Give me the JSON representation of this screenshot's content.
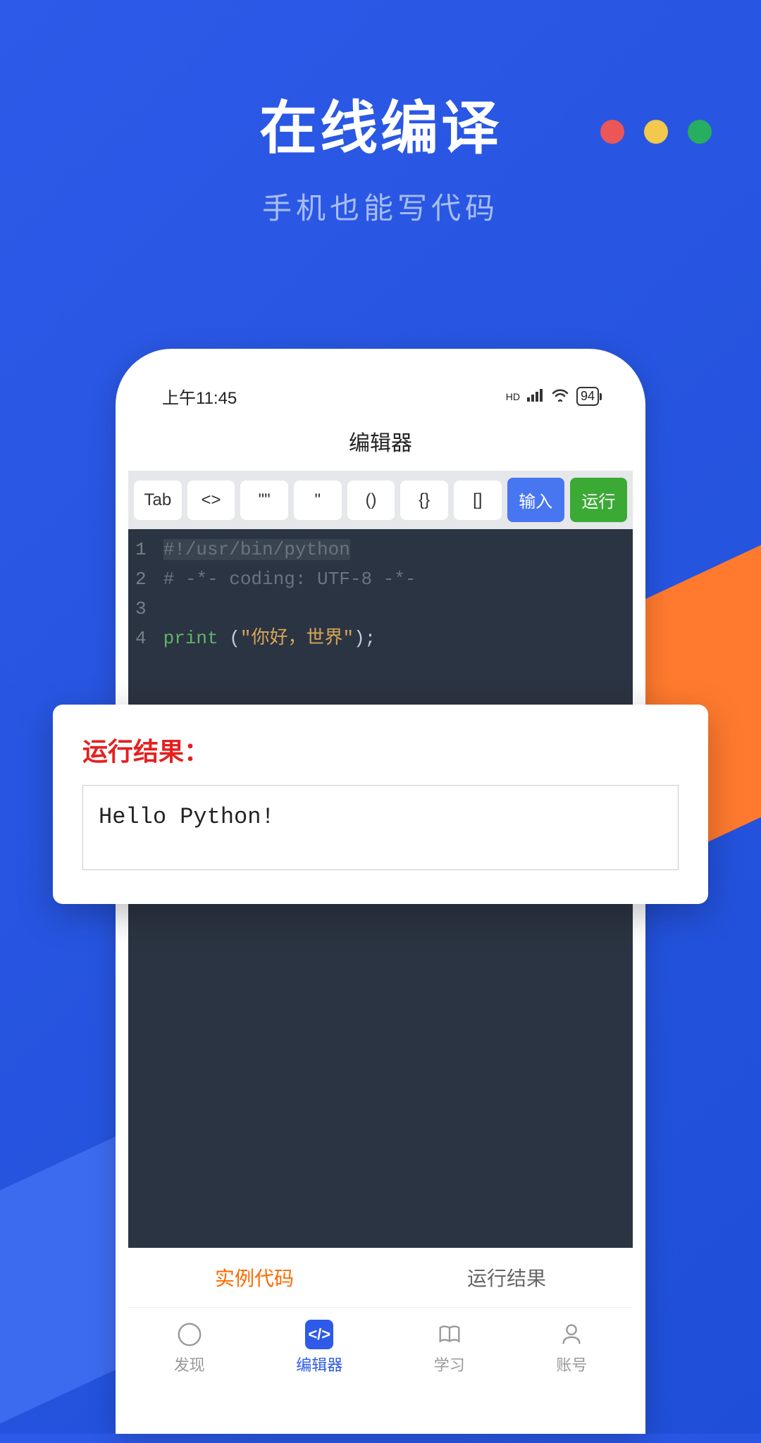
{
  "hero": {
    "title": "在线编译",
    "subtitle": "手机也能写代码"
  },
  "statusBar": {
    "time": "上午11:45",
    "hd": "HD",
    "battery": "94"
  },
  "appTitle": "编辑器",
  "toolbar": {
    "tab": "Tab",
    "angle": "<>",
    "dquote": "\"\"",
    "squote": "\"",
    "paren": "()",
    "brace": "{}",
    "bracket": "[]",
    "input": "输入",
    "run": "运行"
  },
  "code": {
    "lines": [
      {
        "n": "1"
      },
      {
        "n": "2"
      },
      {
        "n": "3"
      },
      {
        "n": "4"
      }
    ],
    "shebang": "#!/usr/bin/python",
    "coding": "# -*- coding: UTF-8 -*-",
    "printFunc": "print ",
    "printOpen": "(",
    "printStr": "\"你好，世界\"",
    "printClose": ");"
  },
  "result": {
    "title": "运行结果：",
    "output": "Hello Python!"
  },
  "phoneTabs": {
    "example": "实例代码",
    "result": "运行结果"
  },
  "bottomNav": {
    "discover": "发现",
    "editor": "编辑器",
    "learn": "学习",
    "account": "账号",
    "codeIcon": "</>"
  }
}
